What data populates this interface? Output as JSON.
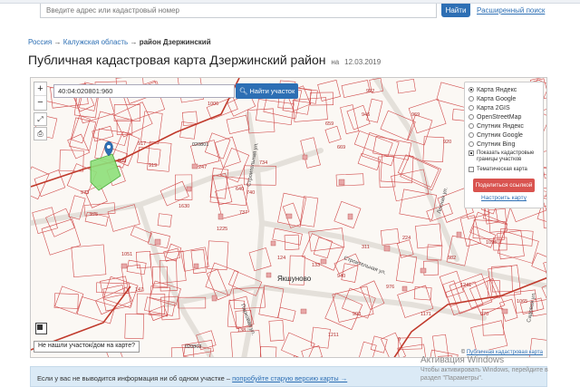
{
  "header": {
    "search_placeholder": "Введите адрес или кадастровый номер",
    "search_button": "Найти",
    "advanced_search": "Расширенный поиск"
  },
  "breadcrumb": {
    "root": "Россия",
    "region": "Калужская область",
    "district": "район Дзержинский"
  },
  "page": {
    "title": "Публичная кадастровая карта Дзержинский район",
    "date_prefix": "на",
    "date": "12.03.2019"
  },
  "map": {
    "cadastral_input": "40:04:020801:960",
    "find_button": "Найти участок",
    "layers": [
      {
        "label": "Карта Яндекс",
        "selected": true
      },
      {
        "label": "Карта Google",
        "selected": false
      },
      {
        "label": "Карта 2GIS",
        "selected": false
      },
      {
        "label": "OpenStreetMap",
        "selected": false
      },
      {
        "label": "Спутник Яндекс",
        "selected": false
      },
      {
        "label": "Спутник Google",
        "selected": false
      },
      {
        "label": "Спутник Bing",
        "selected": false
      }
    ],
    "show_boundaries": "Показать кадастровые границы участков",
    "thematic_map": "Тематическая карта",
    "share_button": "Поделиться ссылкой",
    "configure_link": "Настроить карту",
    "not_found_button": "Не нашли участок/дом на карте?",
    "attribution": "Публичная кадастровая карта",
    "town_label": "Якшуново",
    "streets": [
      "Строительная ул.",
      "Парковая ул.",
      "Лесная ул.",
      "Садовая ул."
    ],
    "parcel_numbers": [
      "917",
      "975",
      "973",
      "909",
      "919",
      "1051",
      "1006",
      "147",
      "247",
      "734",
      "659",
      "669",
      "992",
      "946",
      "969",
      "920",
      "740",
      "1630",
      "737",
      "640",
      "1225",
      "124",
      "133",
      "940",
      "903",
      "976",
      "224",
      "311",
      "1241",
      "970",
      "1171",
      "1065",
      "982",
      "1098",
      "138",
      "1211",
      "9",
      "020801",
      "020803"
    ]
  },
  "info_bar": {
    "text": "Если у вас не выводится информация ни об одном участке –",
    "link": "попробуйте старую версию карты →"
  },
  "watermark": {
    "title": "Активация Windows",
    "line1": "Чтобы активировать Windows, перейдите в",
    "line2": "раздел \"Параметры\"."
  },
  "colors": {
    "accent_blue": "#2d6fb4",
    "share_red": "#d9534f",
    "parcel_line": "#c0392b",
    "selected_parcel": "#7ddf6a",
    "info_bg": "#dbeaf6"
  }
}
